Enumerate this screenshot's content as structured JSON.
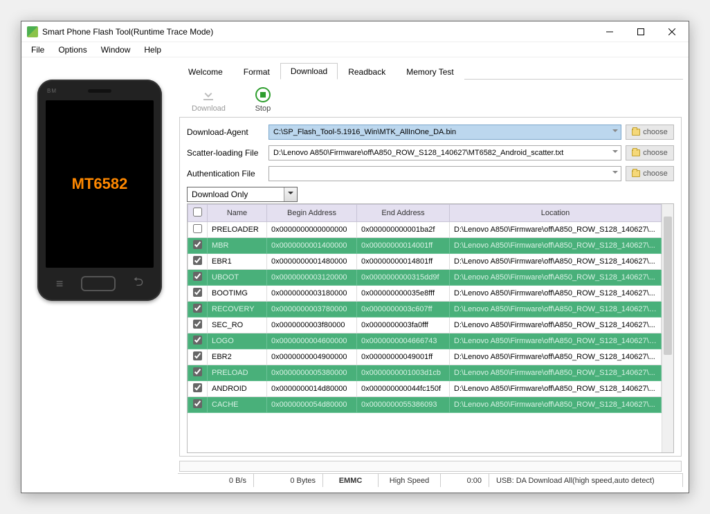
{
  "title": "Smart Phone Flash Tool(Runtime Trace Mode)",
  "menu": [
    "File",
    "Options",
    "Window",
    "Help"
  ],
  "phone": {
    "brand": "BM",
    "chip": "MT6582"
  },
  "tabs": [
    "Welcome",
    "Format",
    "Download",
    "Readback",
    "Memory Test"
  ],
  "active_tab": 2,
  "toolbar": {
    "download": "Download",
    "stop": "Stop"
  },
  "files": {
    "da_label": "Download-Agent",
    "da_value": "C:\\SP_Flash_Tool-5.1916_Win\\MTK_AllInOne_DA.bin",
    "scatter_label": "Scatter-loading File",
    "scatter_value": "D:\\Lenovo A850\\Firmware\\off\\A850_ROW_S128_140627\\MT6582_Android_scatter.txt",
    "auth_label": "Authentication File",
    "auth_value": "",
    "choose": "choose"
  },
  "mode": "Download Only",
  "columns": {
    "name": "Name",
    "begin": "Begin Address",
    "end": "End Address",
    "location": "Location"
  },
  "rows": [
    {
      "ck": false,
      "ghost": false,
      "name": "PRELOADER",
      "begin": "0x0000000000000000",
      "end": "0x000000000001ba2f",
      "loc": "D:\\Lenovo A850\\Firmware\\off\\A850_ROW_S128_140627\\..."
    },
    {
      "ck": true,
      "ghost": true,
      "name": "MBR",
      "begin": "0x0000000001400000",
      "end": "0x00000000014001ff",
      "loc": "D:\\Lenovo A850\\Firmware\\off\\A850_ROW_S128_140627\\..."
    },
    {
      "ck": true,
      "ghost": false,
      "name": "EBR1",
      "begin": "0x0000000001480000",
      "end": "0x00000000014801ff",
      "loc": "D:\\Lenovo A850\\Firmware\\off\\A850_ROW_S128_140627\\..."
    },
    {
      "ck": true,
      "ghost": true,
      "name": "UBOOT",
      "begin": "0x0000000003120000",
      "end": "0x0000000000315dd9f",
      "loc": "D:\\Lenovo A850\\Firmware\\off\\A850_ROW_S128_140627\\..."
    },
    {
      "ck": true,
      "ghost": false,
      "name": "BOOTIMG",
      "begin": "0x0000000003180000",
      "end": "0x000000000035e8fff",
      "loc": "D:\\Lenovo A850\\Firmware\\off\\A850_ROW_S128_140627\\..."
    },
    {
      "ck": true,
      "ghost": true,
      "name": "RECOVERY",
      "begin": "0x0000000003780000",
      "end": "0x0000000003c607ff",
      "loc": "D:\\Lenovo A850\\Firmware\\off\\A850_ROW_S128_140627\\r..."
    },
    {
      "ck": true,
      "ghost": false,
      "name": "SEC_RO",
      "begin": "0x0000000003f80000",
      "end": "0x0000000003fa0fff",
      "loc": "D:\\Lenovo A850\\Firmware\\off\\A850_ROW_S128_140627\\..."
    },
    {
      "ck": true,
      "ghost": true,
      "name": "LOGO",
      "begin": "0x0000000004600000",
      "end": "0x0000000004666743",
      "loc": "D:\\Lenovo A850\\Firmware\\off\\A850_ROW_S128_140627\\l..."
    },
    {
      "ck": true,
      "ghost": false,
      "name": "EBR2",
      "begin": "0x0000000004900000",
      "end": "0x00000000049001ff",
      "loc": "D:\\Lenovo A850\\Firmware\\off\\A850_ROW_S128_140627\\..."
    },
    {
      "ck": true,
      "ghost": true,
      "name": "PRELOAD",
      "begin": "0x0000000005380000",
      "end": "0x0000000001003d1cb",
      "loc": "D:\\Lenovo A850\\Firmware\\off\\A850_ROW_S128_140627\\..."
    },
    {
      "ck": true,
      "ghost": false,
      "name": "ANDROID",
      "begin": "0x0000000014d80000",
      "end": "0x000000000044fc150f",
      "loc": "D:\\Lenovo A850\\Firmware\\off\\A850_ROW_S128_140627\\..."
    },
    {
      "ck": true,
      "ghost": true,
      "name": "CACHE",
      "begin": "0x0000000054d80000",
      "end": "0x0000000055386093",
      "loc": "D:\\Lenovo A850\\Firmware\\off\\A850_ROW_S128_140627\\..."
    }
  ],
  "status": {
    "speed": "0 B/s",
    "bytes": "0 Bytes",
    "storage": "EMMC",
    "mode": "High Speed",
    "time": "0:00",
    "usb": "USB: DA Download All(high speed,auto detect)"
  }
}
